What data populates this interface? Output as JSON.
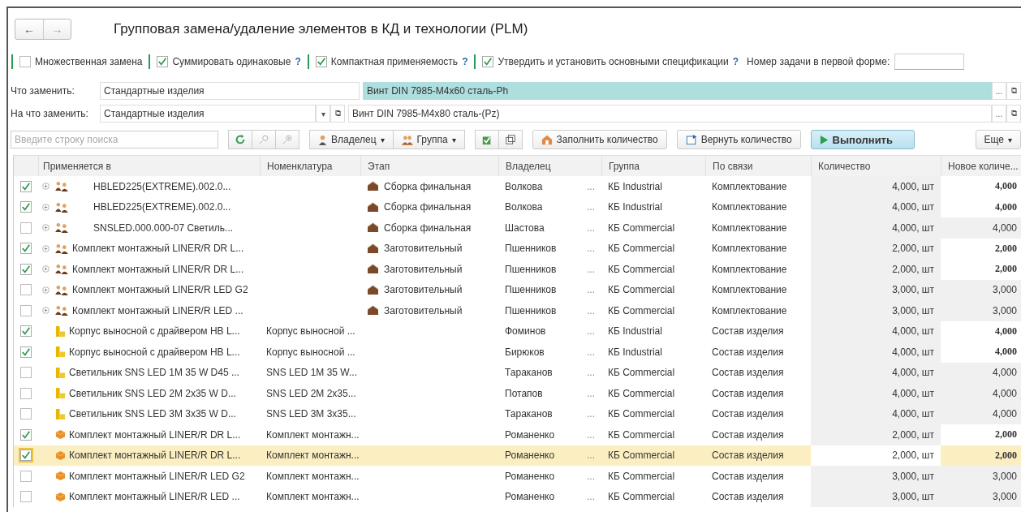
{
  "window": {
    "title": "Групповая замена/удаление элементов в КД и технологии (PLM)",
    "back": "←",
    "forward": "→"
  },
  "options": [
    {
      "kind": "checkbox",
      "label": "Множественная замена",
      "checked": false
    },
    {
      "kind": "checkbox",
      "label": "Суммировать одинаковые",
      "checked": true,
      "help": "?"
    },
    {
      "kind": "checkbox",
      "label": "Компактная применяемость",
      "checked": true,
      "help": "?"
    },
    {
      "kind": "checkbox",
      "label": "Утвердить и установить основными спецификации",
      "checked": true,
      "help": "?"
    }
  ],
  "task_number": {
    "label": "Номер задачи в первой форме:"
  },
  "replace_from": {
    "label": "Что заменить:",
    "type": "Стандартные изделия",
    "item": "Винт DIN 7985-M4x60 сталь-Ph",
    "more": "...",
    "open": "⧉"
  },
  "replace_to": {
    "label": "На что заменить:",
    "type": "Стандартные изделия",
    "type_caret": "▾",
    "type_open": "⧉",
    "item": "Винт DIN 7985-M4x80 сталь-(Pz)",
    "more": "...",
    "open": "⧉"
  },
  "toolbar": {
    "search": {
      "placeholder": "Введите строку поиска"
    },
    "owner": "Владелец",
    "owner_caret": "▾",
    "group": "Группа",
    "group_caret": "▾",
    "fill": "Заполнить количество",
    "restore": "Вернуть количество",
    "run": "Выполнить",
    "more": "Еще",
    "more_caret": "▾"
  },
  "table": {
    "columns": [
      "Применяется в",
      "Номенклатура",
      "Этап",
      "Владелец",
      "Группа",
      "По связи",
      "Количество",
      "Новое количе..."
    ],
    "rows": [
      {
        "checked": true,
        "selected": false,
        "kind": "assembly",
        "expandable": true,
        "indented": true,
        "name": "HBLED225(EXTREME).002.0...",
        "nomenclature": "",
        "stage": "Сборка финальная",
        "owner": "Волкова",
        "more": "...",
        "group": "КБ Industrial",
        "link": "Комплектование",
        "qty": "4,000, шт",
        "new_qty": "4,000",
        "changed": true
      },
      {
        "checked": true,
        "selected": false,
        "kind": "assembly",
        "expandable": true,
        "indented": true,
        "name": "HBLED225(EXTREME).002.0...",
        "nomenclature": "",
        "stage": "Сборка финальная",
        "owner": "Волкова",
        "more": "...",
        "group": "КБ Industrial",
        "link": "Комплектование",
        "qty": "4,000, шт",
        "new_qty": "4,000",
        "changed": true
      },
      {
        "checked": false,
        "selected": false,
        "kind": "assembly",
        "expandable": true,
        "indented": true,
        "name": "SNSLED.000.000-07 Светиль...",
        "nomenclature": "",
        "stage": "Сборка финальная",
        "owner": "Шастова",
        "more": "...",
        "group": "КБ Commercial",
        "link": "Комплектование",
        "qty": "4,000, шт",
        "new_qty": "4,000",
        "changed": false
      },
      {
        "checked": true,
        "selected": false,
        "kind": "assembly",
        "expandable": true,
        "indented": false,
        "name": "Комплект монтажный LINER/R DR L...",
        "nomenclature": "",
        "stage": "Заготовительный",
        "owner": "Пшенников",
        "more": "...",
        "group": "КБ Commercial",
        "link": "Комплектование",
        "qty": "2,000, шт",
        "new_qty": "2,000",
        "changed": true
      },
      {
        "checked": true,
        "selected": false,
        "kind": "assembly",
        "expandable": true,
        "indented": false,
        "name": "Комплект монтажный LINER/R DR L...",
        "nomenclature": "",
        "stage": "Заготовительный",
        "owner": "Пшенников",
        "more": "...",
        "group": "КБ Commercial",
        "link": "Комплектование",
        "qty": "2,000, шт",
        "new_qty": "2,000",
        "changed": true
      },
      {
        "checked": false,
        "selected": false,
        "kind": "assembly",
        "expandable": true,
        "indented": false,
        "name": "Комплект монтажный LINER/R LED G2",
        "nomenclature": "",
        "stage": "Заготовительный",
        "owner": "Пшенников",
        "more": "...",
        "group": "КБ Commercial",
        "link": "Комплектование",
        "qty": "3,000, шт",
        "new_qty": "3,000",
        "changed": false
      },
      {
        "checked": false,
        "selected": false,
        "kind": "assembly",
        "expandable": true,
        "indented": false,
        "name": "Комплект монтажный LINER/R LED ...",
        "nomenclature": "",
        "stage": "Заготовительный",
        "owner": "Пшенников",
        "more": "...",
        "group": "КБ Commercial",
        "link": "Комплектование",
        "qty": "3,000, шт",
        "new_qty": "3,000",
        "changed": false
      },
      {
        "checked": true,
        "selected": false,
        "kind": "part",
        "expandable": false,
        "indented": false,
        "name": "Корпус выносной с драйвером HB L...",
        "nomenclature": "Корпус выносной ...",
        "stage": "",
        "owner": "Фоминов",
        "more": "...",
        "group": "КБ Industrial",
        "link": "Состав изделия",
        "qty": "4,000, шт",
        "new_qty": "4,000",
        "changed": true
      },
      {
        "checked": true,
        "selected": false,
        "kind": "part",
        "expandable": false,
        "indented": false,
        "name": "Корпус выносной с драйвером HB L...",
        "nomenclature": "Корпус выносной ...",
        "stage": "",
        "owner": "Бирюков",
        "more": "...",
        "group": "КБ Industrial",
        "link": "Состав изделия",
        "qty": "4,000, шт",
        "new_qty": "4,000",
        "changed": true
      },
      {
        "checked": false,
        "selected": false,
        "kind": "part",
        "expandable": false,
        "indented": false,
        "name": "Светильник SNS LED 1M 35 W D45 ...",
        "nomenclature": "SNS LED 1M 35 W...",
        "stage": "",
        "owner": "Тараканов",
        "more": "...",
        "group": "КБ Commercial",
        "link": "Состав изделия",
        "qty": "4,000, шт",
        "new_qty": "4,000",
        "changed": false
      },
      {
        "checked": false,
        "selected": false,
        "kind": "part",
        "expandable": false,
        "indented": false,
        "name": "Светильник SNS LED 2M 2x35 W D...",
        "nomenclature": "SNS LED 2M 2x35...",
        "stage": "",
        "owner": "Потапов",
        "more": "...",
        "group": "КБ Commercial",
        "link": "Состав изделия",
        "qty": "4,000, шт",
        "new_qty": "4,000",
        "changed": false
      },
      {
        "checked": false,
        "selected": false,
        "kind": "part",
        "expandable": false,
        "indented": false,
        "name": "Светильник SNS LED 3M 3x35 W D...",
        "nomenclature": "SNS LED 3M 3x35...",
        "stage": "",
        "owner": "Тараканов",
        "more": "...",
        "group": "КБ Commercial",
        "link": "Состав изделия",
        "qty": "4,000, шт",
        "new_qty": "4,000",
        "changed": false
      },
      {
        "checked": true,
        "selected": false,
        "kind": "kit",
        "expandable": false,
        "indented": false,
        "name": "Комплект монтажный LINER/R DR L...",
        "nomenclature": "Комплект монтажн...",
        "stage": "",
        "owner": "Романенко",
        "more": "...",
        "group": "КБ Commercial",
        "link": "Состав изделия",
        "qty": "2,000, шт",
        "new_qty": "2,000",
        "changed": true
      },
      {
        "checked": true,
        "selected": true,
        "kind": "kit",
        "expandable": false,
        "indented": false,
        "name": "Комплект монтажный LINER/R DR L...",
        "nomenclature": "Комплект монтажн...",
        "stage": "",
        "owner": "Романенко",
        "more": "...",
        "group": "КБ Commercial",
        "link": "Состав изделия",
        "qty": "2,000, шт",
        "new_qty": "2,000",
        "changed": true
      },
      {
        "checked": false,
        "selected": false,
        "kind": "kit",
        "expandable": false,
        "indented": false,
        "name": "Комплект монтажный LINER/R LED G2",
        "nomenclature": "Комплект монтажн...",
        "stage": "",
        "owner": "Романенко",
        "more": "...",
        "group": "КБ Commercial",
        "link": "Состав изделия",
        "qty": "3,000, шт",
        "new_qty": "3,000",
        "changed": false
      },
      {
        "checked": false,
        "selected": false,
        "kind": "kit",
        "expandable": false,
        "indented": false,
        "name": "Комплект монтажный LINER/R LED ...",
        "nomenclature": "Комплект монтажн...",
        "stage": "",
        "owner": "Романенко",
        "more": "...",
        "group": "КБ Commercial",
        "link": "Состав изделия",
        "qty": "3,000, шт",
        "new_qty": "3,000",
        "changed": false
      }
    ]
  }
}
